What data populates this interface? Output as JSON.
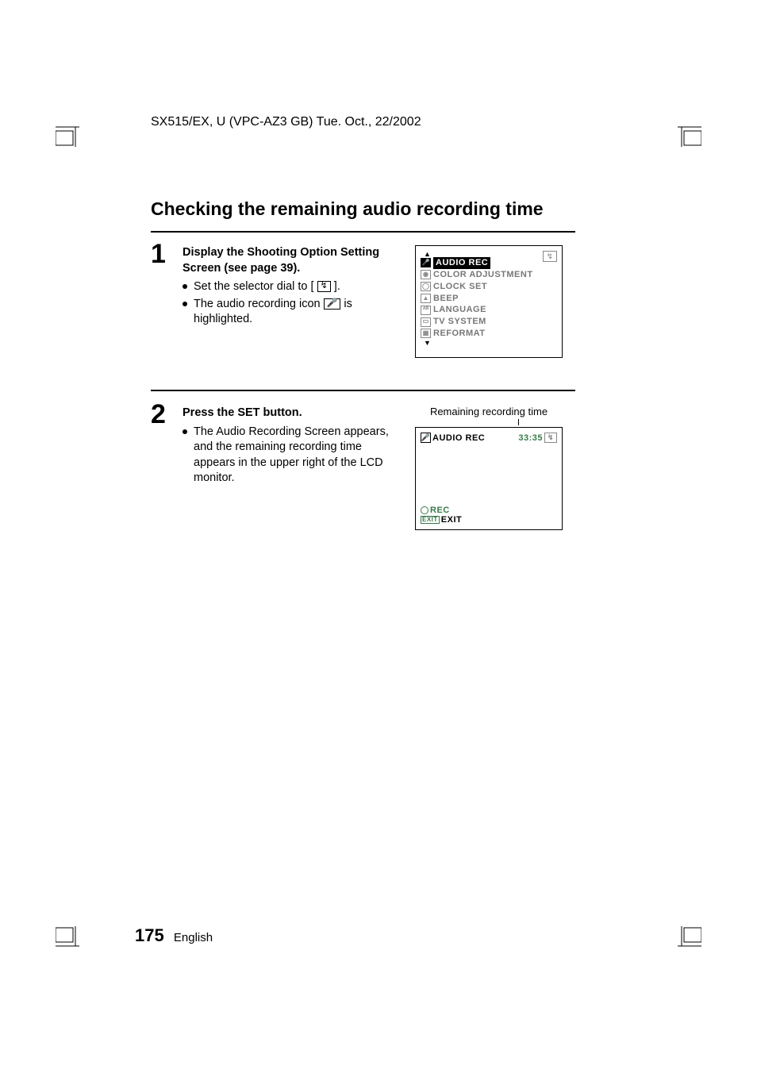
{
  "header": "SX515/EX, U (VPC-AZ3 GB)    Tue. Oct., 22/2002",
  "title": "Checking the remaining audio recording time",
  "step1": {
    "num": "1",
    "heading": "Display the Shooting Option Setting Screen (see page 39).",
    "b1_pre": "Set the selector dial to [ ",
    "b1_post": " ].",
    "b2_pre": "The audio recording icon ",
    "b2_post": " is highlighted."
  },
  "lcd1": {
    "corner_icon": "↯",
    "items": [
      {
        "icon": "🎤",
        "label": "AUDIO REC",
        "sel": true
      },
      {
        "icon": "◉",
        "label": "COLOR ADJUSTMENT",
        "sel": false
      },
      {
        "icon": "◯",
        "label": "CLOCK SET",
        "sel": false
      },
      {
        "icon": "▲",
        "label": "BEEP",
        "sel": false
      },
      {
        "icon": "ᴬᴮ",
        "label": "LANGUAGE",
        "sel": false
      },
      {
        "icon": "▭",
        "label": "TV SYSTEM",
        "sel": false
      },
      {
        "icon": "▦",
        "label": "REFORMAT",
        "sel": false
      }
    ]
  },
  "step2": {
    "num": "2",
    "heading": "Press the SET button.",
    "b1": "The Audio Recording Screen appears, and the remaining recording time appears in the upper right of the LCD monitor.",
    "caption": "Remaining recording time"
  },
  "lcd2": {
    "top_left": "AUDIO REC",
    "mic_glyph": "🎤",
    "time": "33:35",
    "corner_icon": "↯",
    "rec_label": "REC",
    "exit_box": "EXIT",
    "exit_label": "EXIT"
  },
  "footer": {
    "page": "175",
    "lang": "English"
  }
}
